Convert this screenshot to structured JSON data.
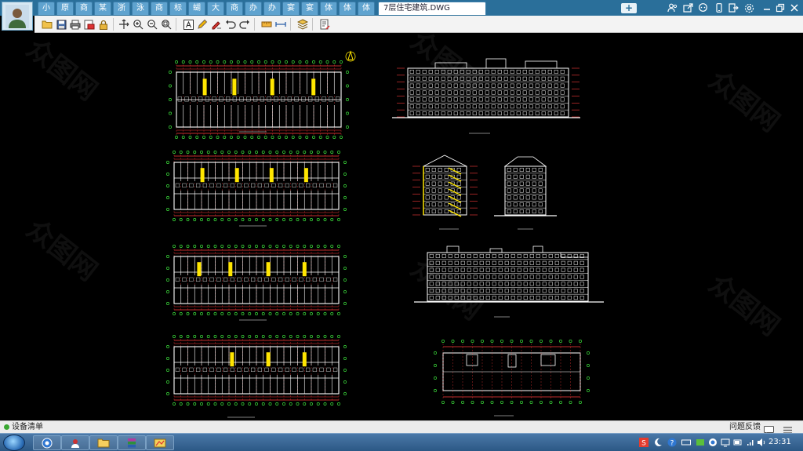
{
  "window": {
    "active_tab_title": "7层住宅建筑.DWG",
    "tabs": [
      "小",
      "原",
      "商",
      "某",
      "浙",
      "泳",
      "商",
      "标",
      "蝴",
      "大",
      "商",
      "办",
      "办",
      "宴",
      "宴",
      "体",
      "体",
      "体"
    ],
    "add_tab_label": "+"
  },
  "titlebar_icons": [
    "people-icon",
    "share-icon",
    "chat-icon",
    "mobile-icon",
    "exit-icon",
    "settings-icon",
    "minimize-icon",
    "restore-icon",
    "close-icon"
  ],
  "toolbar": {
    "icons": [
      "open-folder-icon",
      "save-icon",
      "print-icon",
      "export-icon",
      "lock-icon",
      "pan-icon",
      "zoom-in-icon",
      "zoom-out-icon",
      "zoom-extents-icon",
      "text-icon",
      "pencil-icon",
      "cloud-markup-icon",
      "undo-icon",
      "redo-icon",
      "measure-icon",
      "dimension-icon",
      "layers-icon",
      "properties-icon"
    ]
  },
  "drawing": {
    "background_color": "#000000",
    "line_color": "#ffffff",
    "grid_color": "#ff3b3b",
    "axis_color": "#3bdc3b",
    "stair_color": "#ffe600",
    "watermark": "众图网"
  },
  "statusbar": {
    "label": "设备清单",
    "feedback": "问题反馈"
  },
  "taskbar": {
    "clock": "23:31"
  }
}
